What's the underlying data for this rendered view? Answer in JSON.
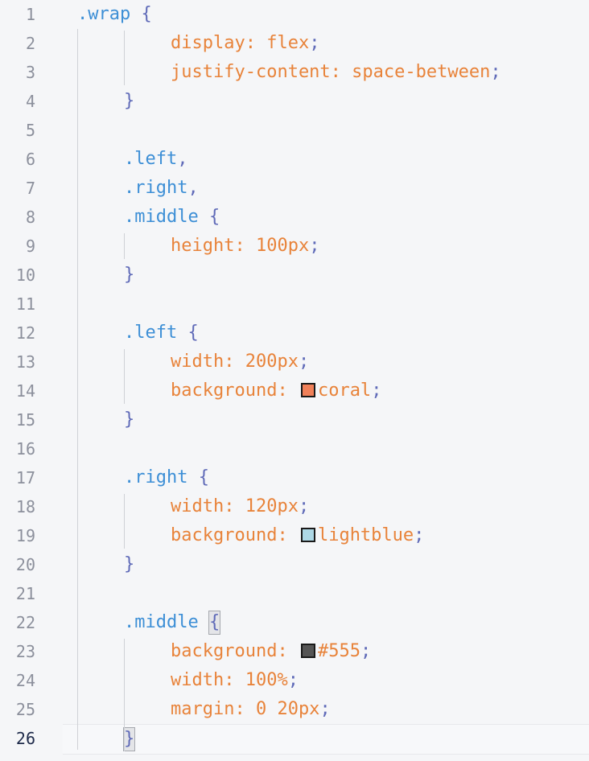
{
  "editor": {
    "current_line": 26,
    "colors": {
      "selector": "#3d8fd6",
      "property": "#e8833a",
      "punctuation": "#5f6ab8",
      "line_number": "#8c909c",
      "background": "#f5f6f8"
    },
    "lines": [
      {
        "n": "1",
        "text": [
          {
            "c": "selector",
            "v": ".wrap"
          },
          {
            "c": "punct",
            "v": " {"
          }
        ],
        "indent": 0
      },
      {
        "n": "2",
        "text": [
          {
            "c": "prop",
            "v": "display: flex"
          },
          {
            "c": "punct",
            "v": ";"
          }
        ],
        "indent": 2
      },
      {
        "n": "3",
        "text": [
          {
            "c": "prop",
            "v": "justify-content: space-between"
          },
          {
            "c": "punct",
            "v": ";"
          }
        ],
        "indent": 2
      },
      {
        "n": "4",
        "text": [
          {
            "c": "punct",
            "v": "}"
          }
        ],
        "indent": 1
      },
      {
        "n": "5",
        "text": [],
        "indent": 0
      },
      {
        "n": "6",
        "text": [
          {
            "c": "selector",
            "v": ".left"
          },
          {
            "c": "punct",
            "v": ","
          }
        ],
        "indent": 1
      },
      {
        "n": "7",
        "text": [
          {
            "c": "selector",
            "v": ".right"
          },
          {
            "c": "punct",
            "v": ","
          }
        ],
        "indent": 1
      },
      {
        "n": "8",
        "text": [
          {
            "c": "selector",
            "v": ".middle"
          },
          {
            "c": "punct",
            "v": " {"
          }
        ],
        "indent": 1
      },
      {
        "n": "9",
        "text": [
          {
            "c": "prop",
            "v": "height: 100px"
          },
          {
            "c": "punct",
            "v": ";"
          }
        ],
        "indent": 2
      },
      {
        "n": "10",
        "text": [
          {
            "c": "punct",
            "v": "}"
          }
        ],
        "indent": 1
      },
      {
        "n": "11",
        "text": [],
        "indent": 0
      },
      {
        "n": "12",
        "text": [
          {
            "c": "selector",
            "v": ".left"
          },
          {
            "c": "punct",
            "v": " {"
          }
        ],
        "indent": 1
      },
      {
        "n": "13",
        "text": [
          {
            "c": "prop",
            "v": "width: 200px"
          },
          {
            "c": "punct",
            "v": ";"
          }
        ],
        "indent": 2
      },
      {
        "n": "14",
        "text": [
          {
            "c": "prop",
            "v": "background: "
          },
          {
            "c": "swatch",
            "v": "#f08059"
          },
          {
            "c": "prop",
            "v": "coral"
          },
          {
            "c": "punct",
            "v": ";"
          }
        ],
        "indent": 2
      },
      {
        "n": "15",
        "text": [
          {
            "c": "punct",
            "v": "}"
          }
        ],
        "indent": 1
      },
      {
        "n": "16",
        "text": [],
        "indent": 0
      },
      {
        "n": "17",
        "text": [
          {
            "c": "selector",
            "v": ".right"
          },
          {
            "c": "punct",
            "v": " {"
          }
        ],
        "indent": 1
      },
      {
        "n": "18",
        "text": [
          {
            "c": "prop",
            "v": "width: 120px"
          },
          {
            "c": "punct",
            "v": ";"
          }
        ],
        "indent": 2
      },
      {
        "n": "19",
        "text": [
          {
            "c": "prop",
            "v": "background: "
          },
          {
            "c": "swatch",
            "v": "#add8e6"
          },
          {
            "c": "prop",
            "v": "lightblue"
          },
          {
            "c": "punct",
            "v": ";"
          }
        ],
        "indent": 2
      },
      {
        "n": "20",
        "text": [
          {
            "c": "punct",
            "v": "}"
          }
        ],
        "indent": 1
      },
      {
        "n": "21",
        "text": [],
        "indent": 0
      },
      {
        "n": "22",
        "text": [
          {
            "c": "selector",
            "v": ".middle"
          },
          {
            "c": "punct",
            "v": " "
          },
          {
            "c": "match",
            "v": "{"
          }
        ],
        "indent": 1
      },
      {
        "n": "23",
        "text": [
          {
            "c": "prop",
            "v": "background: "
          },
          {
            "c": "swatch",
            "v": "#555555"
          },
          {
            "c": "prop",
            "v": "#555"
          },
          {
            "c": "punct",
            "v": ";"
          }
        ],
        "indent": 2
      },
      {
        "n": "24",
        "text": [
          {
            "c": "prop",
            "v": "width: 100%"
          },
          {
            "c": "punct",
            "v": ";"
          }
        ],
        "indent": 2
      },
      {
        "n": "25",
        "text": [
          {
            "c": "prop",
            "v": "margin: 0 20px"
          },
          {
            "c": "punct",
            "v": ";"
          }
        ],
        "indent": 2
      },
      {
        "n": "26",
        "text": [
          {
            "c": "match",
            "v": "}"
          }
        ],
        "indent": 1
      }
    ]
  }
}
